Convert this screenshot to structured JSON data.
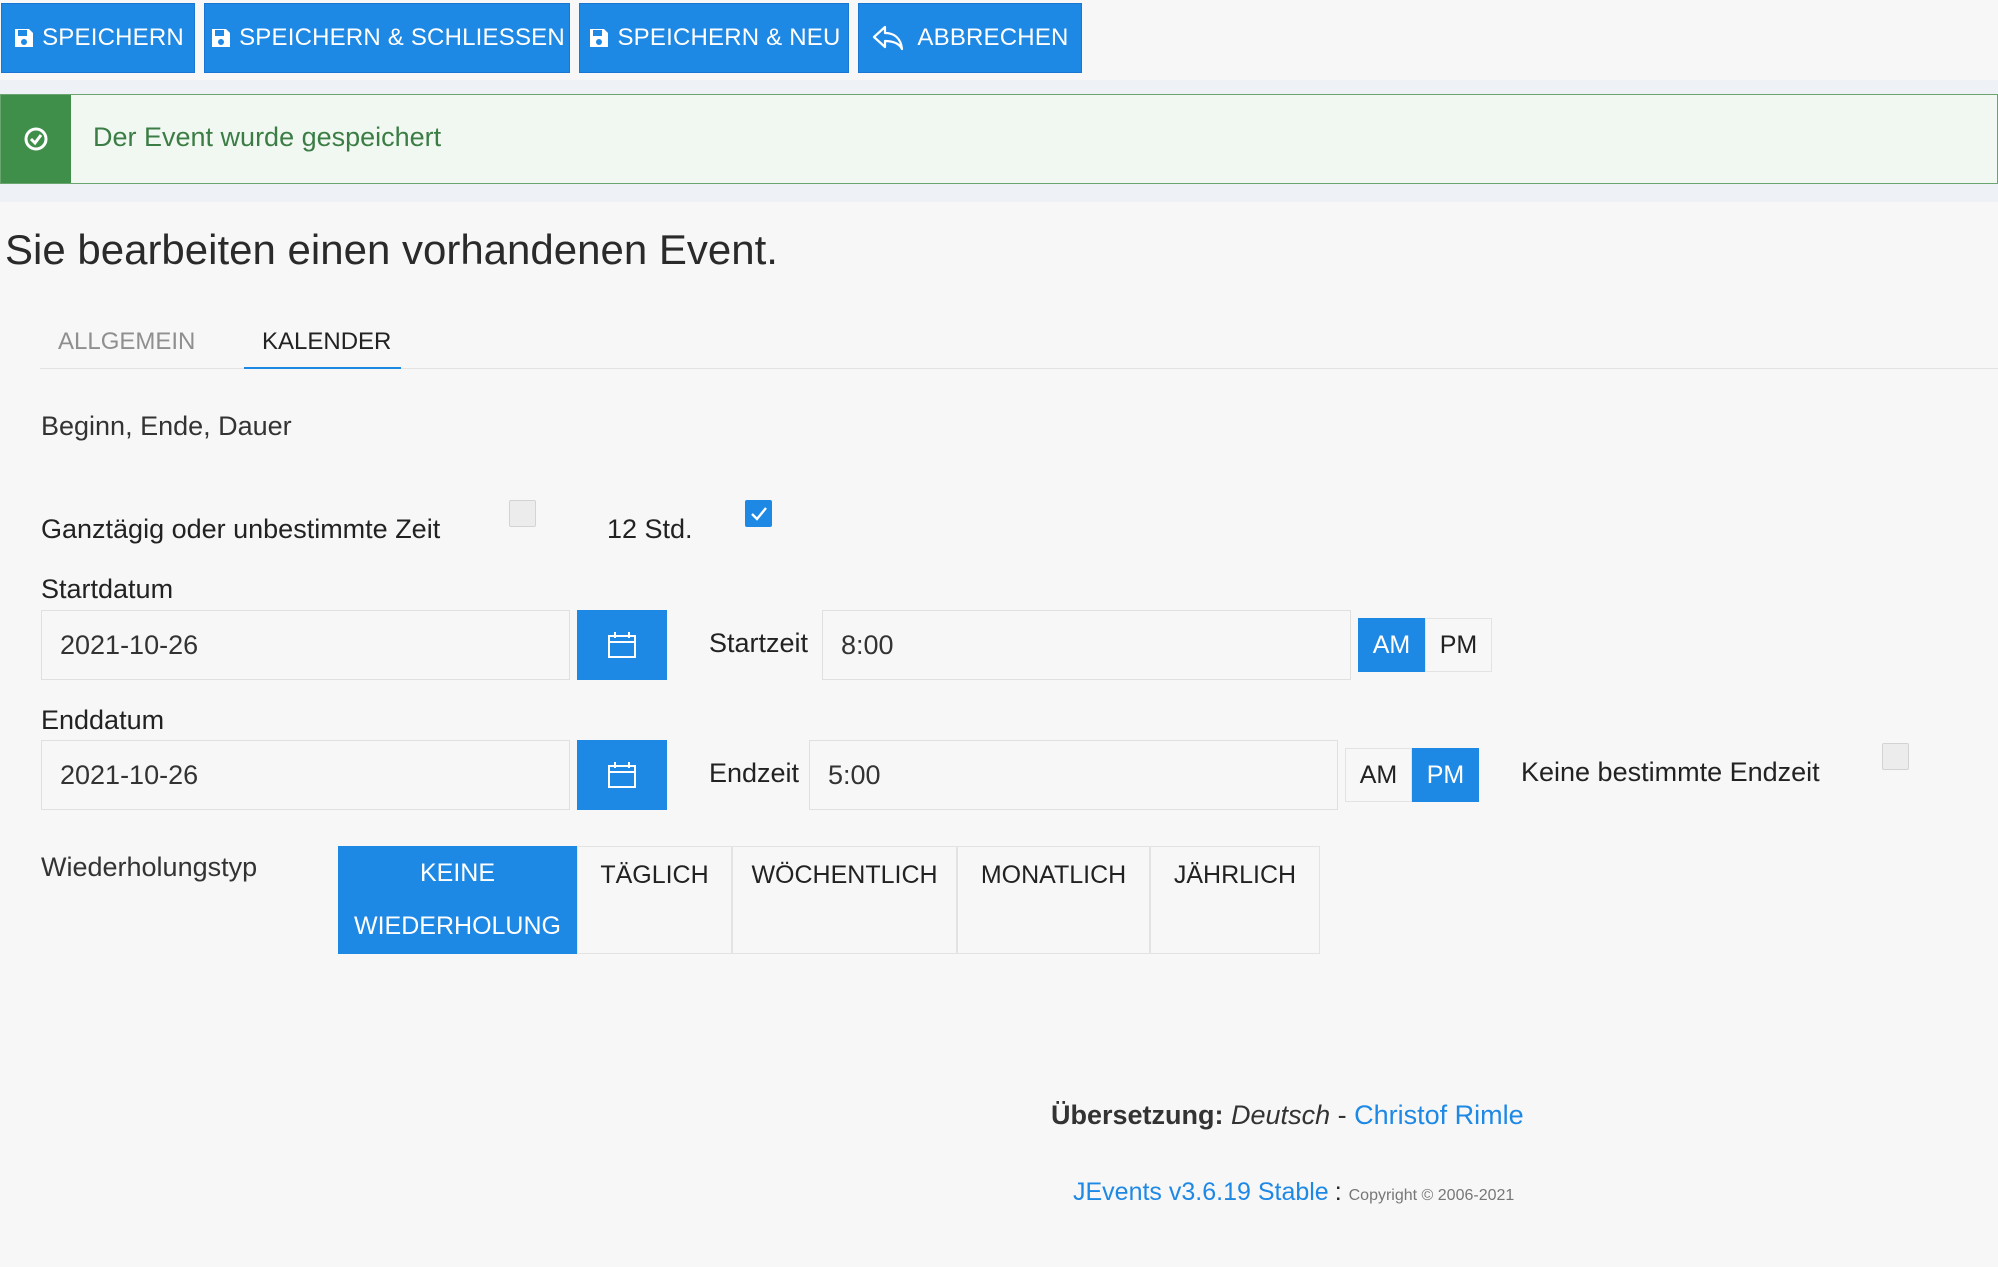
{
  "toolbar": {
    "save_label": "SPEICHERN",
    "save_close_label": "SPEICHERN & SCHLIESSEN",
    "save_new_label": "SPEICHERN & NEU",
    "cancel_label": "ABBRECHEN"
  },
  "alert": {
    "message": "Der Event wurde gespeichert",
    "color": "#3f8e4a"
  },
  "page": {
    "title": "Sie bearbeiten einen vorhandenen Event."
  },
  "tabs": [
    {
      "label": "ALLGEMEIN",
      "active": false
    },
    {
      "label": "KALENDER",
      "active": true
    }
  ],
  "section": {
    "heading": "Beginn, Ende, Dauer",
    "all_day_label": "Ganztägig oder unbestimmte Zeit",
    "all_day_checked": false,
    "twelve_hour_label": "12 Std.",
    "twelve_hour_checked": true
  },
  "start": {
    "date_label": "Startdatum",
    "date_value": "2021-10-26",
    "time_label": "Startzeit",
    "time_value": "8:00",
    "am_label": "AM",
    "pm_label": "PM",
    "selected": "AM"
  },
  "end": {
    "date_label": "Enddatum",
    "date_value": "2021-10-26",
    "time_label": "Endzeit",
    "time_value": "5:00",
    "am_label": "AM",
    "pm_label": "PM",
    "selected": "PM",
    "no_end_label": "Keine bestimmte Endzeit",
    "no_end_checked": false
  },
  "repeat": {
    "label": "Wiederholungstyp",
    "options": [
      {
        "line1": "KEINE",
        "line2": "WIEDERHOLUNG",
        "active": true
      },
      {
        "line1": "TÄGLICH",
        "active": false
      },
      {
        "line1": "WÖCHENTLICH",
        "active": false
      },
      {
        "line1": "MONATLICH",
        "active": false
      },
      {
        "line1": "JÄHRLICH",
        "active": false
      }
    ]
  },
  "footer": {
    "translation_label": "Übersetzung:",
    "language": "Deutsch",
    "separator": "-",
    "translator": "Christof Rimle",
    "product": "JEvents v3.6.19 Stable",
    "colon": ":",
    "copyright": "Copyright © 2006-2021"
  },
  "colors": {
    "accent": "#1e88e5",
    "success": "#3f8e4a"
  }
}
